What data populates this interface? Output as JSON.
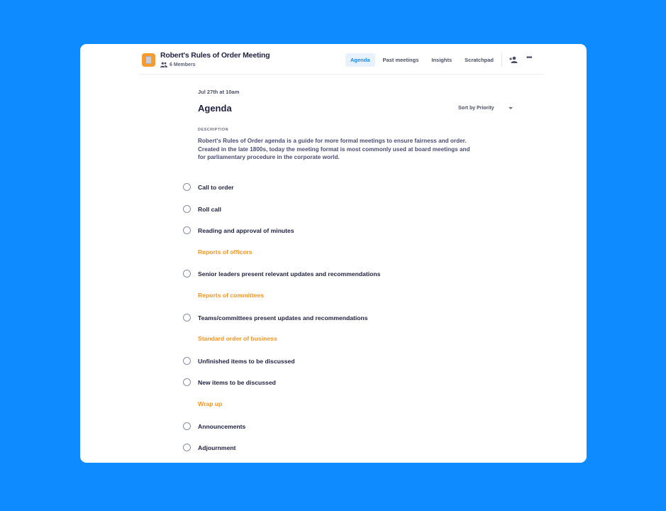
{
  "header": {
    "title": "Robert's Rules of Order Meeting",
    "members": "6 Members",
    "tabs": [
      {
        "label": "Agenda",
        "active": true
      },
      {
        "label": "Past meetings",
        "active": false
      },
      {
        "label": "Insights",
        "active": false
      },
      {
        "label": "Scratchpad",
        "active": false
      }
    ],
    "icons": {
      "add_member": "add-user-icon",
      "more": "more-icon",
      "members": "people-icon",
      "logo": "notebook-icon"
    },
    "more_glyph": "•••"
  },
  "colors": {
    "background": "#0d8bff",
    "accent": "#1a86f2",
    "section": "#f7941d",
    "logo": "#f89a2e"
  },
  "main": {
    "date": "Jul 27th at 10am",
    "title": "Agenda",
    "sort_label": "Sort by Priority",
    "description_label": "DESCRIPTION",
    "description": "Robert's Rules of Order agenda is a guide for more formal meetings to ensure fairness and order. Created in the late 1800s, today the meeting format is most commonly used at board meetings and for parliamentary procedure in the corporate world.",
    "items": [
      {
        "type": "item",
        "label": "Call to order"
      },
      {
        "type": "item",
        "label": "Roll call"
      },
      {
        "type": "item",
        "label": "Reading and approval of minutes"
      },
      {
        "type": "section",
        "label": "Reports of officers"
      },
      {
        "type": "item",
        "label": "Senior leaders present relevant updates and recommendations"
      },
      {
        "type": "section",
        "label": "Reports of committees"
      },
      {
        "type": "item",
        "label": "Teams/committees present updates and recommendations"
      },
      {
        "type": "section",
        "label": "Standard order of business"
      },
      {
        "type": "item",
        "label": "Unfinished items to be discussed"
      },
      {
        "type": "item",
        "label": "New items to be discussed"
      },
      {
        "type": "section",
        "label": "Wrap up"
      },
      {
        "type": "item",
        "label": "Announcements"
      },
      {
        "type": "item",
        "label": "Adjournment"
      }
    ]
  }
}
